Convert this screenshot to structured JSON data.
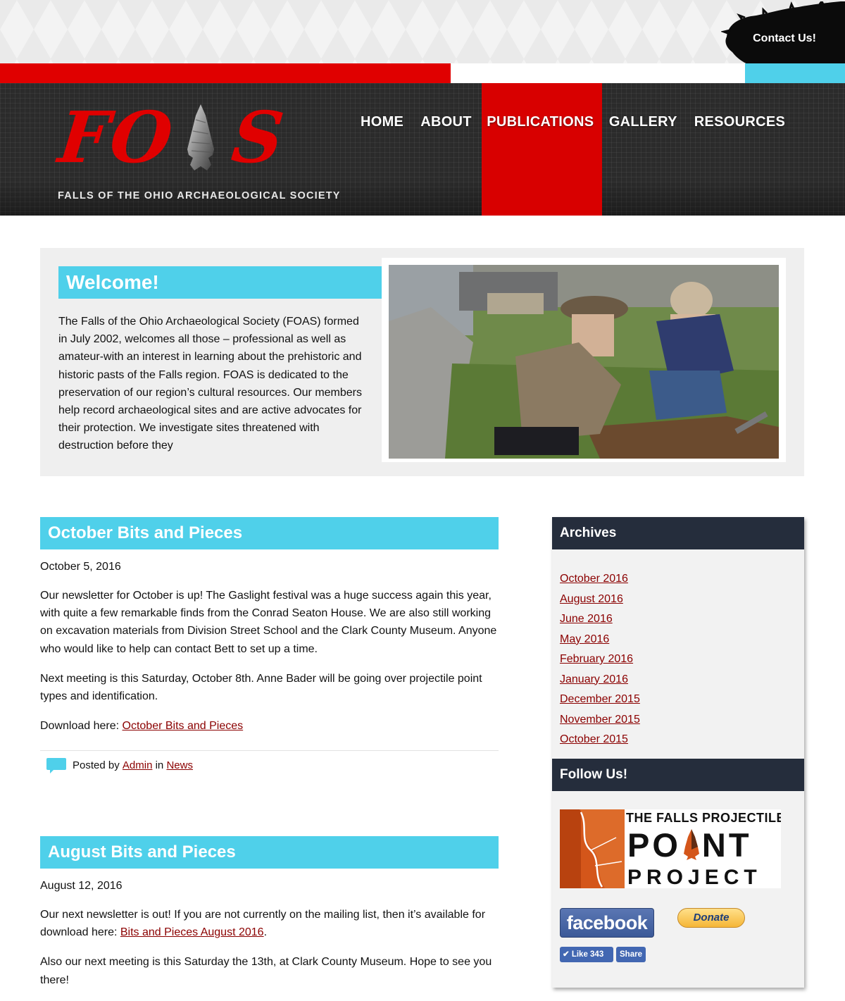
{
  "header": {
    "contact_label": "Contact Us!",
    "logo_letters": [
      "F",
      "O",
      "S"
    ],
    "logo_tagline": "FALLS OF THE OHIO ARCHAEOLOGICAL SOCIETY",
    "nav": [
      {
        "label": "HOME",
        "active": false
      },
      {
        "label": "ABOUT",
        "active": false
      },
      {
        "label": "PUBLICATIONS",
        "active": true
      },
      {
        "label": "GALLERY",
        "active": false
      },
      {
        "label": "RESOURCES",
        "active": false
      }
    ]
  },
  "welcome": {
    "title": "Welcome!",
    "text": "The Falls of the Ohio Archaeological Society (FOAS) formed in July 2002, welcomes all those – professional as well as amateur-with an interest in learning about the prehistoric and historic pasts of the Falls region. FOAS is dedicated to the preservation of our region’s cultural resources. Our members help record archaeological sites and are active advocates for their protection. We investigate sites threatened with destruction before they"
  },
  "posts": [
    {
      "title": "October Bits and Pieces",
      "date": "October 5, 2016",
      "p1_line1": "Our newsletter for October is up! The Gaslight festival was a huge success again this year, with quite a few remarkable finds from the Conrad Seaton House. We are also still working on excavation materials from Division Street School and the Clark County Museum. Anyone",
      "p1_line2": "who would like to help can contact Bett to set up a time.",
      "p2": "Next meeting is this Saturday, October 8th. Anne Bader will be going over projectile point types and identification.",
      "p3_prefix": "Download here: ",
      "p3_link": "October Bits and Pieces",
      "meta_prefix": "Posted by ",
      "meta_author": "Admin",
      "meta_in": " in ",
      "meta_category": "News"
    },
    {
      "title": "August Bits and Pieces",
      "date": "August 12, 2016",
      "p1_prefix": "Our next newsletter is out! If you are not currently on the mailing list, then it’s available for download here: ",
      "p1_link": "Bits and Pieces August 2016",
      "p1_suffix": ".",
      "p2": "Also our next meeting is this Saturday the 13th, at Clark County Museum. Hope to see you there!"
    }
  ],
  "sidebar": {
    "archives_title": "Archives",
    "archives": [
      "October 2016",
      "August 2016",
      "June 2016",
      "May 2016",
      "February 2016",
      "January 2016",
      "December 2015",
      "November 2015",
      "October 2015"
    ],
    "follow_title": "Follow Us!",
    "banner_line1": "THE FALLS PROJECTILE",
    "banner_line2_a": "PO",
    "banner_line2_b": "NT",
    "banner_line3": "PROJECT",
    "facebook_label": "facebook",
    "donate_label": "Donate",
    "like_label": "✔ Like 343",
    "share_label": "Share"
  },
  "colors": {
    "accent_blue": "#4fd0ea",
    "brand_red": "#e00000",
    "dark_navy": "#252d3c",
    "link": "#8b0000"
  }
}
